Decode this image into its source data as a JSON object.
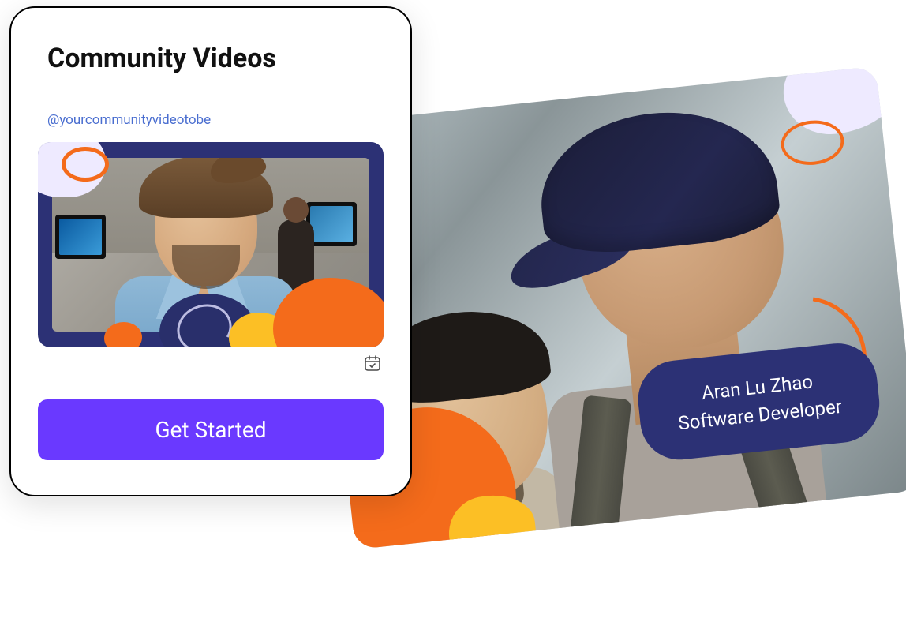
{
  "colors": {
    "accent": "#6a39ff",
    "navy": "#2c3175",
    "orange": "#f46b1b",
    "yellow": "#fcbf25",
    "lilac": "#eeeaff",
    "link": "#4a6ed0"
  },
  "card": {
    "title": "Community Videos",
    "handle": "@yourcommunityvideotobe",
    "cta_label": "Get Started"
  },
  "profile": {
    "name": "Aran Lu Zhao",
    "role": "Software Developer"
  },
  "icons": {
    "calendar": "calendar-icon"
  }
}
